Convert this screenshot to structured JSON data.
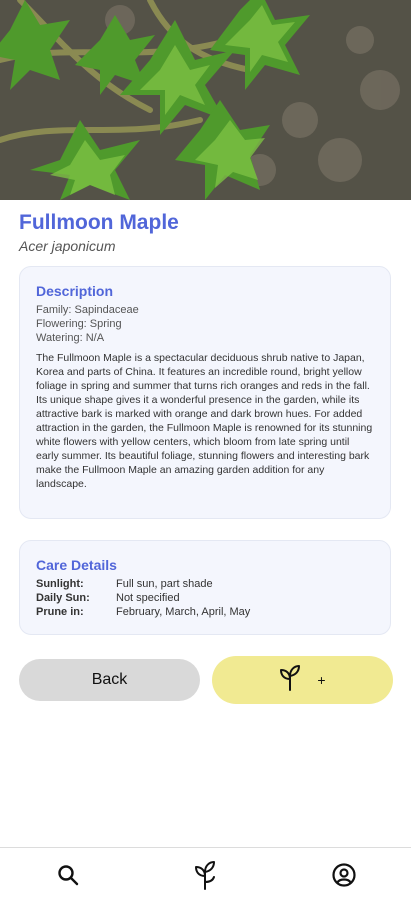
{
  "plant": {
    "name": "Fullmoon Maple",
    "scientific_name": "Acer japonicum"
  },
  "description": {
    "heading": "Description",
    "family": "Family: Sapindaceae",
    "flowering": "Flowering: Spring",
    "watering": "Watering: N/A",
    "text": "The Fullmoon Maple is a spectacular deciduous shrub native to Japan, Korea and parts of China. It features an incredible round, bright yellow foliage in spring and summer that turns rich oranges and reds in the fall. Its unique shape gives it a wonderful presence in the garden, while its attractive bark is marked with orange and dark brown hues. For added attraction in the garden, the Fullmoon Maple is renowned for its stunning white flowers with yellow centers, which bloom from late spring until early summer. Its beautiful foliage, stunning flowers and interesting bark make the Fullmoon Maple an amazing garden addition for any landscape."
  },
  "care": {
    "heading": "Care Details",
    "rows": [
      {
        "label": "Sunlight:",
        "value": "Full sun, part shade"
      },
      {
        "label": "Daily Sun:",
        "value": "Not specified"
      },
      {
        "label": "Prune in:",
        "value": "February, March, April, May"
      }
    ]
  },
  "actions": {
    "back_label": "Back",
    "add_label": "+"
  },
  "nav": {
    "items": [
      "search-icon",
      "plant-icon",
      "profile-icon"
    ]
  },
  "colors": {
    "accent": "#5166d9",
    "add_button": "#f1ea92",
    "back_button": "#d9d9d9"
  }
}
